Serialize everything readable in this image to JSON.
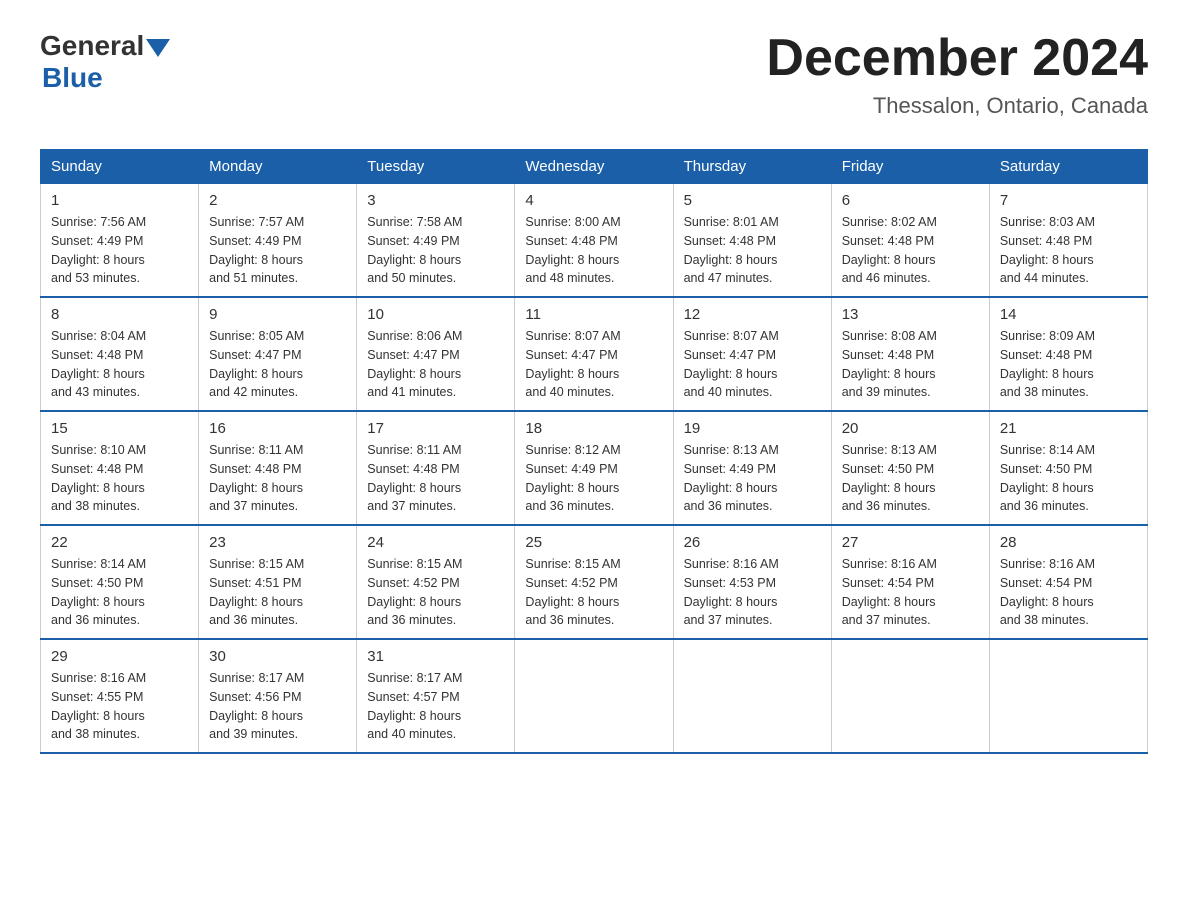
{
  "header": {
    "logo": {
      "general": "General",
      "blue": "Blue"
    },
    "title": "December 2024",
    "location": "Thessalon, Ontario, Canada"
  },
  "days_of_week": [
    "Sunday",
    "Monday",
    "Tuesday",
    "Wednesday",
    "Thursday",
    "Friday",
    "Saturday"
  ],
  "weeks": [
    [
      {
        "day": "1",
        "sunrise": "7:56 AM",
        "sunset": "4:49 PM",
        "daylight": "8 hours and 53 minutes."
      },
      {
        "day": "2",
        "sunrise": "7:57 AM",
        "sunset": "4:49 PM",
        "daylight": "8 hours and 51 minutes."
      },
      {
        "day": "3",
        "sunrise": "7:58 AM",
        "sunset": "4:49 PM",
        "daylight": "8 hours and 50 minutes."
      },
      {
        "day": "4",
        "sunrise": "8:00 AM",
        "sunset": "4:48 PM",
        "daylight": "8 hours and 48 minutes."
      },
      {
        "day": "5",
        "sunrise": "8:01 AM",
        "sunset": "4:48 PM",
        "daylight": "8 hours and 47 minutes."
      },
      {
        "day": "6",
        "sunrise": "8:02 AM",
        "sunset": "4:48 PM",
        "daylight": "8 hours and 46 minutes."
      },
      {
        "day": "7",
        "sunrise": "8:03 AM",
        "sunset": "4:48 PM",
        "daylight": "8 hours and 44 minutes."
      }
    ],
    [
      {
        "day": "8",
        "sunrise": "8:04 AM",
        "sunset": "4:48 PM",
        "daylight": "8 hours and 43 minutes."
      },
      {
        "day": "9",
        "sunrise": "8:05 AM",
        "sunset": "4:47 PM",
        "daylight": "8 hours and 42 minutes."
      },
      {
        "day": "10",
        "sunrise": "8:06 AM",
        "sunset": "4:47 PM",
        "daylight": "8 hours and 41 minutes."
      },
      {
        "day": "11",
        "sunrise": "8:07 AM",
        "sunset": "4:47 PM",
        "daylight": "8 hours and 40 minutes."
      },
      {
        "day": "12",
        "sunrise": "8:07 AM",
        "sunset": "4:47 PM",
        "daylight": "8 hours and 40 minutes."
      },
      {
        "day": "13",
        "sunrise": "8:08 AM",
        "sunset": "4:48 PM",
        "daylight": "8 hours and 39 minutes."
      },
      {
        "day": "14",
        "sunrise": "8:09 AM",
        "sunset": "4:48 PM",
        "daylight": "8 hours and 38 minutes."
      }
    ],
    [
      {
        "day": "15",
        "sunrise": "8:10 AM",
        "sunset": "4:48 PM",
        "daylight": "8 hours and 38 minutes."
      },
      {
        "day": "16",
        "sunrise": "8:11 AM",
        "sunset": "4:48 PM",
        "daylight": "8 hours and 37 minutes."
      },
      {
        "day": "17",
        "sunrise": "8:11 AM",
        "sunset": "4:48 PM",
        "daylight": "8 hours and 37 minutes."
      },
      {
        "day": "18",
        "sunrise": "8:12 AM",
        "sunset": "4:49 PM",
        "daylight": "8 hours and 36 minutes."
      },
      {
        "day": "19",
        "sunrise": "8:13 AM",
        "sunset": "4:49 PM",
        "daylight": "8 hours and 36 minutes."
      },
      {
        "day": "20",
        "sunrise": "8:13 AM",
        "sunset": "4:50 PM",
        "daylight": "8 hours and 36 minutes."
      },
      {
        "day": "21",
        "sunrise": "8:14 AM",
        "sunset": "4:50 PM",
        "daylight": "8 hours and 36 minutes."
      }
    ],
    [
      {
        "day": "22",
        "sunrise": "8:14 AM",
        "sunset": "4:50 PM",
        "daylight": "8 hours and 36 minutes."
      },
      {
        "day": "23",
        "sunrise": "8:15 AM",
        "sunset": "4:51 PM",
        "daylight": "8 hours and 36 minutes."
      },
      {
        "day": "24",
        "sunrise": "8:15 AM",
        "sunset": "4:52 PM",
        "daylight": "8 hours and 36 minutes."
      },
      {
        "day": "25",
        "sunrise": "8:15 AM",
        "sunset": "4:52 PM",
        "daylight": "8 hours and 36 minutes."
      },
      {
        "day": "26",
        "sunrise": "8:16 AM",
        "sunset": "4:53 PM",
        "daylight": "8 hours and 37 minutes."
      },
      {
        "day": "27",
        "sunrise": "8:16 AM",
        "sunset": "4:54 PM",
        "daylight": "8 hours and 37 minutes."
      },
      {
        "day": "28",
        "sunrise": "8:16 AM",
        "sunset": "4:54 PM",
        "daylight": "8 hours and 38 minutes."
      }
    ],
    [
      {
        "day": "29",
        "sunrise": "8:16 AM",
        "sunset": "4:55 PM",
        "daylight": "8 hours and 38 minutes."
      },
      {
        "day": "30",
        "sunrise": "8:17 AM",
        "sunset": "4:56 PM",
        "daylight": "8 hours and 39 minutes."
      },
      {
        "day": "31",
        "sunrise": "8:17 AM",
        "sunset": "4:57 PM",
        "daylight": "8 hours and 40 minutes."
      },
      null,
      null,
      null,
      null
    ]
  ]
}
